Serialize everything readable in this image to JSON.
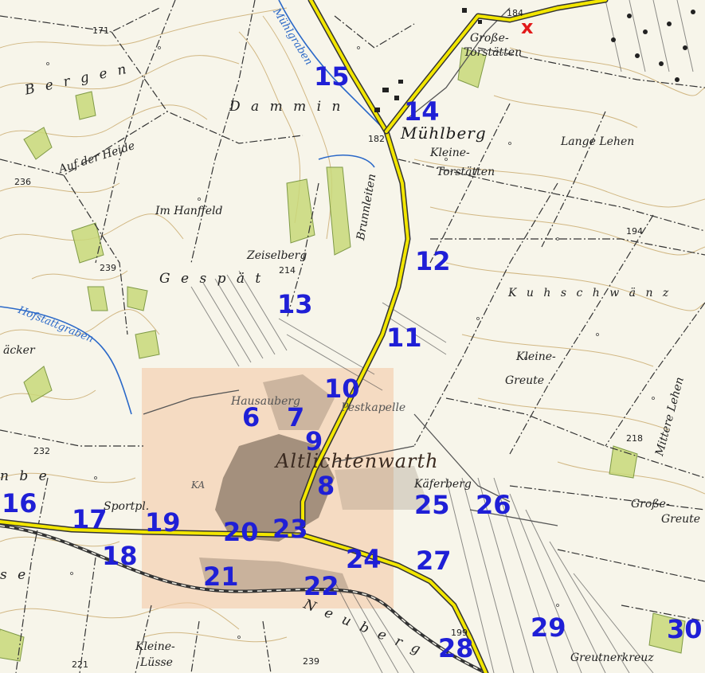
{
  "places": [
    {
      "key": "bergen",
      "text": "B e r g e n"
    },
    {
      "key": "dammin",
      "text": "D a m m i n"
    },
    {
      "key": "muehlberg",
      "text": "Mühlberg"
    },
    {
      "key": "grosse_torstaetten",
      "text": "Große-"
    },
    {
      "key": "grosse_torstaetten2",
      "text": "Torstätten"
    },
    {
      "key": "kleine_torstaetten",
      "text": "Kleine-"
    },
    {
      "key": "kleine_torstaetten2",
      "text": "Torstätten"
    },
    {
      "key": "lange_lehen",
      "text": "Lange Lehen"
    },
    {
      "key": "auf_der_heide",
      "text": "Auf der Heide"
    },
    {
      "key": "im_hanffeld",
      "text": "Im Hanffeld"
    },
    {
      "key": "zeiselberg",
      "text": "Zeiselberg"
    },
    {
      "key": "gespaet",
      "text": "G e s p ä t"
    },
    {
      "key": "brunnleiten",
      "text": "Brunnleiten"
    },
    {
      "key": "kuhschwaenz",
      "text": "K u h s c h w ä n z"
    },
    {
      "key": "kleine_greute",
      "text": "Kleine-"
    },
    {
      "key": "kleine_greute2",
      "text": "Greute"
    },
    {
      "key": "mittere_lehen",
      "text": "Mittere Lehen"
    },
    {
      "key": "grosse_greute",
      "text": "Große-"
    },
    {
      "key": "grosse_greute2",
      "text": "Greute"
    },
    {
      "key": "aecker",
      "text": "äcker"
    },
    {
      "key": "hausauberg",
      "text": "Hausauberg"
    },
    {
      "key": "pestkapelle",
      "text": "Pestkapelle"
    },
    {
      "key": "altlichtenwarth",
      "text": "Altlichtenwarth"
    },
    {
      "key": "kellerberg",
      "text": "Käferberg"
    },
    {
      "key": "sportpl",
      "text": "Sportpl."
    },
    {
      "key": "neuberg",
      "text": "N e u b e r g"
    },
    {
      "key": "kleine_luesse",
      "text": "Kleine-"
    },
    {
      "key": "kleine_luesse2",
      "text": "Lüsse"
    },
    {
      "key": "greutnerkreuz",
      "text": "Greutnerkreuz"
    },
    {
      "key": "nbe",
      "text": "n b e"
    },
    {
      "key": "se",
      "text": "s e"
    },
    {
      "key": "ka",
      "text": "KA"
    }
  ],
  "waters": [
    {
      "key": "hofstattgraben",
      "text": "Hofstattgraben"
    },
    {
      "key": "muehlgraben",
      "text": "Mühlgraben"
    }
  ],
  "elevations": [
    {
      "key": "e171",
      "text": "171"
    },
    {
      "key": "e184",
      "text": "184"
    },
    {
      "key": "e182",
      "text": "182"
    },
    {
      "key": "e236",
      "text": "236"
    },
    {
      "key": "e239a",
      "text": "239"
    },
    {
      "key": "e214",
      "text": "214"
    },
    {
      "key": "e194",
      "text": "194"
    },
    {
      "key": "e232",
      "text": "232"
    },
    {
      "key": "e218",
      "text": "218"
    },
    {
      "key": "e221",
      "text": "221"
    },
    {
      "key": "e239b",
      "text": "239"
    },
    {
      "key": "e199",
      "text": "199"
    }
  ],
  "markers": [
    {
      "id": "6",
      "label": "6"
    },
    {
      "id": "7",
      "label": "7"
    },
    {
      "id": "8",
      "label": "8"
    },
    {
      "id": "9",
      "label": "9"
    },
    {
      "id": "10",
      "label": "10"
    },
    {
      "id": "11",
      "label": "11"
    },
    {
      "id": "12",
      "label": "12"
    },
    {
      "id": "13",
      "label": "13"
    },
    {
      "id": "14",
      "label": "14"
    },
    {
      "id": "15",
      "label": "15"
    },
    {
      "id": "16",
      "label": "16"
    },
    {
      "id": "17",
      "label": "17"
    },
    {
      "id": "18",
      "label": "18"
    },
    {
      "id": "19",
      "label": "19"
    },
    {
      "id": "20",
      "label": "20"
    },
    {
      "id": "21",
      "label": "21"
    },
    {
      "id": "22",
      "label": "22"
    },
    {
      "id": "23",
      "label": "23"
    },
    {
      "id": "24",
      "label": "24"
    },
    {
      "id": "25",
      "label": "25"
    },
    {
      "id": "26",
      "label": "26"
    },
    {
      "id": "27",
      "label": "27"
    },
    {
      "id": "28",
      "label": "28"
    },
    {
      "id": "29",
      "label": "29"
    },
    {
      "id": "30",
      "label": "30"
    }
  ],
  "start_marker": {
    "label": "x",
    "color": "#e21a1a"
  },
  "colors": {
    "background": "#f7f5ea",
    "marker_numbers": "#1f1fd6",
    "main_road": "#f2e600",
    "water": "#2a68c8",
    "village_highlight": "#f3c9a6",
    "contour": "#c8a86a",
    "vineyard": "#c9d97a"
  }
}
